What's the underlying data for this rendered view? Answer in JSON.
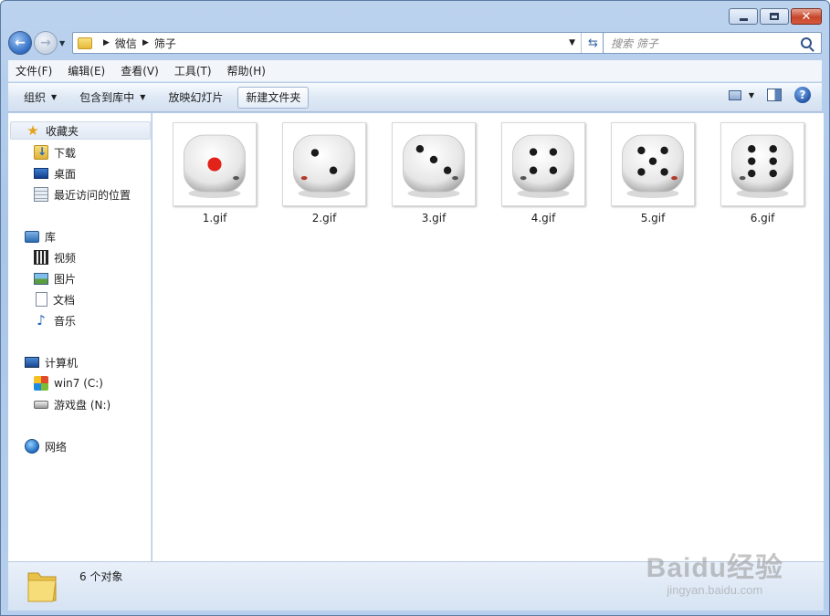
{
  "window": {
    "caption_buttons": [
      "minimize",
      "maximize",
      "close"
    ]
  },
  "address_bar": {
    "path": [
      "微信",
      "筛子"
    ]
  },
  "search": {
    "placeholder": "搜索 筛子"
  },
  "menu": [
    "文件(F)",
    "编辑(E)",
    "查看(V)",
    "工具(T)",
    "帮助(H)"
  ],
  "commands": {
    "organize": "组织",
    "include_library": "包含到库中",
    "slideshow": "放映幻灯片",
    "new_folder": "新建文件夹"
  },
  "sidebar": {
    "favorites": {
      "label": "收藏夹",
      "items": [
        "下载",
        "桌面",
        "最近访问的位置"
      ]
    },
    "libraries": {
      "label": "库",
      "items": [
        "视频",
        "图片",
        "文档",
        "音乐"
      ]
    },
    "computer": {
      "label": "计算机",
      "items": [
        "win7 (C:)",
        "游戏盘 (N:)"
      ]
    },
    "network": {
      "label": "网络"
    }
  },
  "files": [
    {
      "name": "1.gif",
      "pips": 1
    },
    {
      "name": "2.gif",
      "pips": 2
    },
    {
      "name": "3.gif",
      "pips": 3
    },
    {
      "name": "4.gif",
      "pips": 4
    },
    {
      "name": "5.gif",
      "pips": 5
    },
    {
      "name": "6.gif",
      "pips": 6
    }
  ],
  "details": {
    "count": "6 个对象"
  },
  "watermark": {
    "line1": "Baidu经验",
    "line2": "jingyan.baidu.com"
  },
  "colors": {
    "pip_red": "#e2231a",
    "pip_black": "#1a1a1a",
    "window_frame": "#bcd3ee"
  }
}
